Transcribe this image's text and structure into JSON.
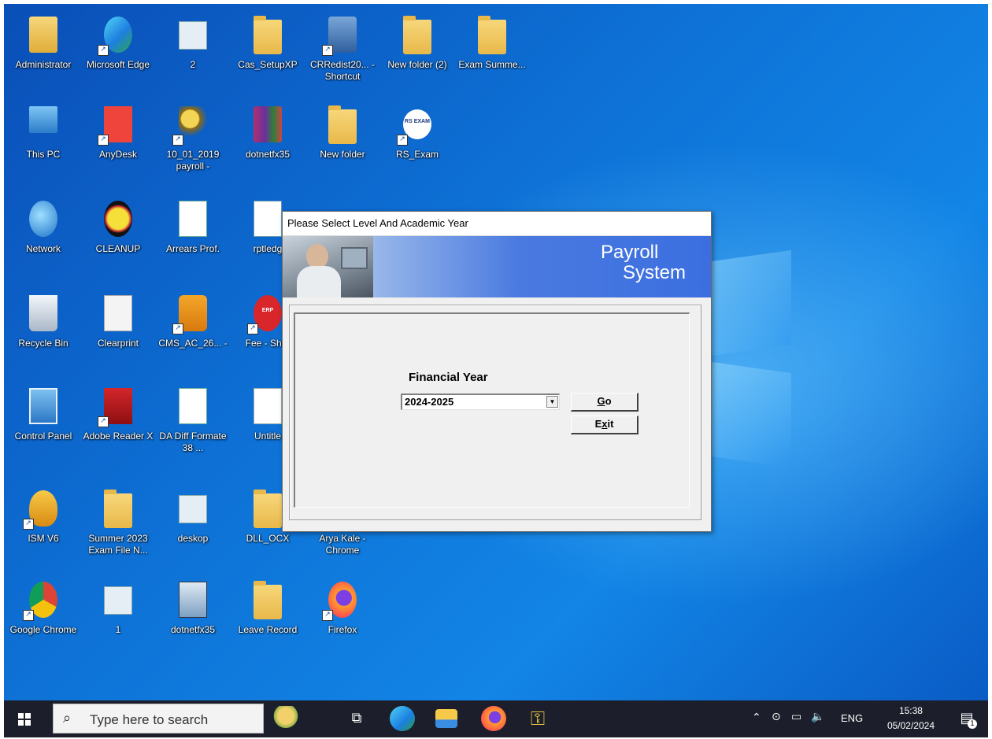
{
  "desktop": {
    "icons": [
      {
        "label": "Administrator",
        "icon": "user-folder-icon"
      },
      {
        "label": "Microsoft Edge",
        "icon": "edge-icon"
      },
      {
        "label": "2",
        "icon": "image-thumbnail-icon"
      },
      {
        "label": "Cas_SetupXP",
        "icon": "folder-icon"
      },
      {
        "label": "CRRedist20... - Shortcut",
        "icon": "installer-icon"
      },
      {
        "label": "New folder (2)",
        "icon": "folder-icon"
      },
      {
        "label": "Exam Summe...",
        "icon": "folder-icon"
      },
      {
        "label": "This PC",
        "icon": "computer-icon"
      },
      {
        "label": "AnyDesk",
        "icon": "anydesk-icon"
      },
      {
        "label": "10_01_2019 payroll -",
        "icon": "keys-icon"
      },
      {
        "label": "dotnetfx35",
        "icon": "winrar-icon"
      },
      {
        "label": "New folder",
        "icon": "folder-icon"
      },
      {
        "label": "RS_Exam",
        "icon": "rs-exam-icon",
        "badge": "RS EXAM"
      },
      {
        "label": "Network",
        "icon": "network-icon"
      },
      {
        "label": "CLEANUP",
        "icon": "cleanup-icon"
      },
      {
        "label": "Arrears Prof.",
        "icon": "excel-file-icon"
      },
      {
        "label": "rptledg",
        "icon": "word-file-icon"
      },
      {
        "label": "Recycle Bin",
        "icon": "recycle-bin-icon"
      },
      {
        "label": "Clearprint",
        "icon": "gears-icon"
      },
      {
        "label": "CMS_AC_26... -",
        "icon": "key-app-icon"
      },
      {
        "label": "Fee - Shor",
        "icon": "erp-icon",
        "badge": "ERP"
      },
      {
        "label": "Control Panel",
        "icon": "control-panel-icon"
      },
      {
        "label": "Adobe Reader X",
        "icon": "adobe-reader-icon"
      },
      {
        "label": "DA Diff Formate 38 ...",
        "icon": "excel-file-icon"
      },
      {
        "label": "Untitle",
        "icon": "document-icon"
      },
      {
        "label": "ISM V6",
        "icon": "ism-icon"
      },
      {
        "label": "Summer 2023 Exam File N...",
        "icon": "folder-icon"
      },
      {
        "label": "deskop",
        "icon": "image-thumbnail-icon"
      },
      {
        "label": "DLL_OCX",
        "icon": "folder-icon"
      },
      {
        "label": "Arya Kale - Chrome",
        "icon": "chrome-profile-icon"
      },
      {
        "label": "Google Chrome",
        "icon": "chrome-icon"
      },
      {
        "label": "1",
        "icon": "image-thumbnail-icon"
      },
      {
        "label": "dotnetfx35",
        "icon": "setup-icon"
      },
      {
        "label": "Leave Record",
        "icon": "folder-icon"
      },
      {
        "label": "Firefox",
        "icon": "firefox-icon"
      }
    ]
  },
  "dialog": {
    "title": "Please Select Level And Academic Year",
    "banner_line1": "Payroll",
    "banner_line2": "System",
    "fy_label": "Financial Year",
    "fy_value": "2024-2025",
    "go_label": "Go",
    "go_mnemonic": "G",
    "exit_label": "Exit",
    "exit_mnemonic": "x"
  },
  "taskbar": {
    "search_placeholder": "Type here to search",
    "apps": [
      "cup-icon",
      "task-view-icon",
      "edge-icon",
      "file-explorer-icon",
      "firefox-icon",
      "keys-icon"
    ],
    "tray_lang": "ENG",
    "time": "15:38",
    "date": "05/02/2024",
    "notification_count": "1"
  },
  "colors": {
    "desktop_blue": "#0e74d8",
    "taskbar": "#1c1f2b",
    "banner_blue": "#3b6ee0"
  }
}
